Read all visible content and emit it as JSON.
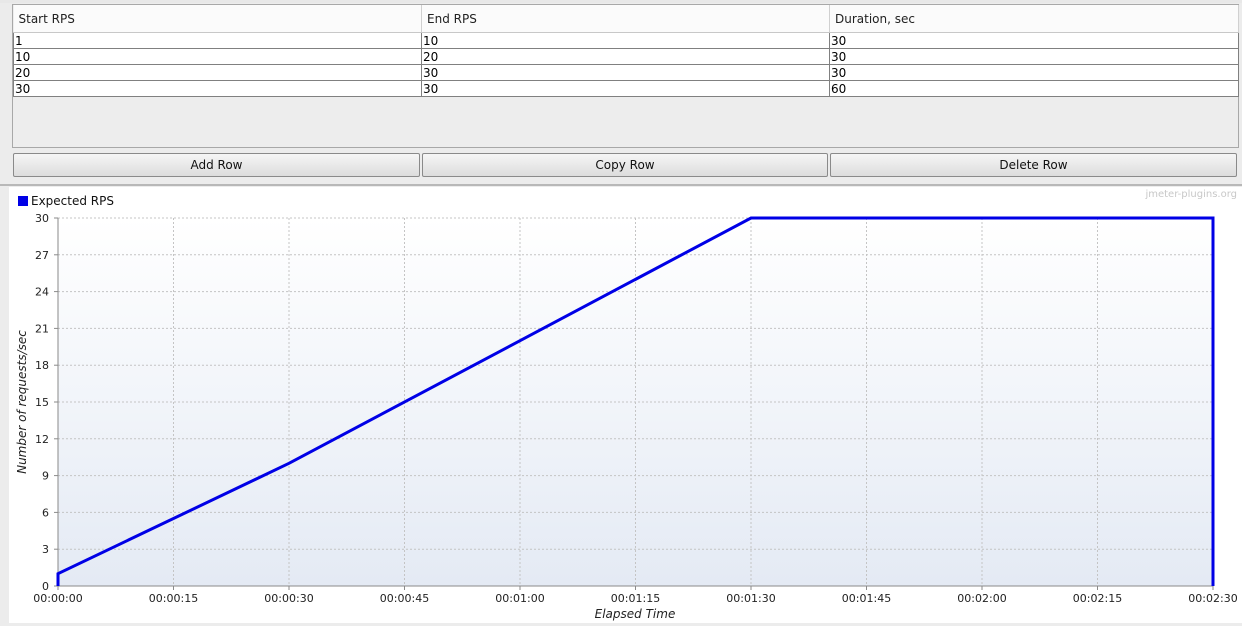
{
  "table": {
    "columns": [
      "Start RPS",
      "End RPS",
      "Duration, sec"
    ],
    "rows": [
      [
        "1",
        "10",
        "30"
      ],
      [
        "10",
        "20",
        "30"
      ],
      [
        "20",
        "30",
        "30"
      ],
      [
        "30",
        "30",
        "60"
      ]
    ]
  },
  "buttons": {
    "add": "Add Row",
    "copy": "Copy Row",
    "delete": "Delete Row"
  },
  "chart": {
    "watermark": "jmeter-plugins.org",
    "line_color": "#0000e6"
  },
  "chart_data": {
    "type": "line",
    "xlabel": "Elapsed Time",
    "ylabel": "Number of requests/sec",
    "xlim": [
      0,
      150
    ],
    "ylim": [
      0,
      30
    ],
    "x_ticks": [
      0,
      15,
      30,
      45,
      60,
      75,
      90,
      105,
      120,
      135,
      150
    ],
    "x_tick_labels": [
      "00:00:00",
      "00:00:15",
      "00:00:30",
      "00:00:45",
      "00:01:00",
      "00:01:15",
      "00:01:30",
      "00:01:45",
      "00:02:00",
      "00:02:15",
      "00:02:30"
    ],
    "y_ticks": [
      0,
      3,
      6,
      9,
      12,
      15,
      18,
      21,
      24,
      27,
      30
    ],
    "grid": true,
    "legend_position": "top-left",
    "series": [
      {
        "name": "Expected RPS",
        "x": [
          0,
          0,
          30,
          60,
          90,
          150,
          150
        ],
        "y": [
          0,
          1,
          10,
          20,
          30,
          30,
          0
        ]
      }
    ]
  }
}
